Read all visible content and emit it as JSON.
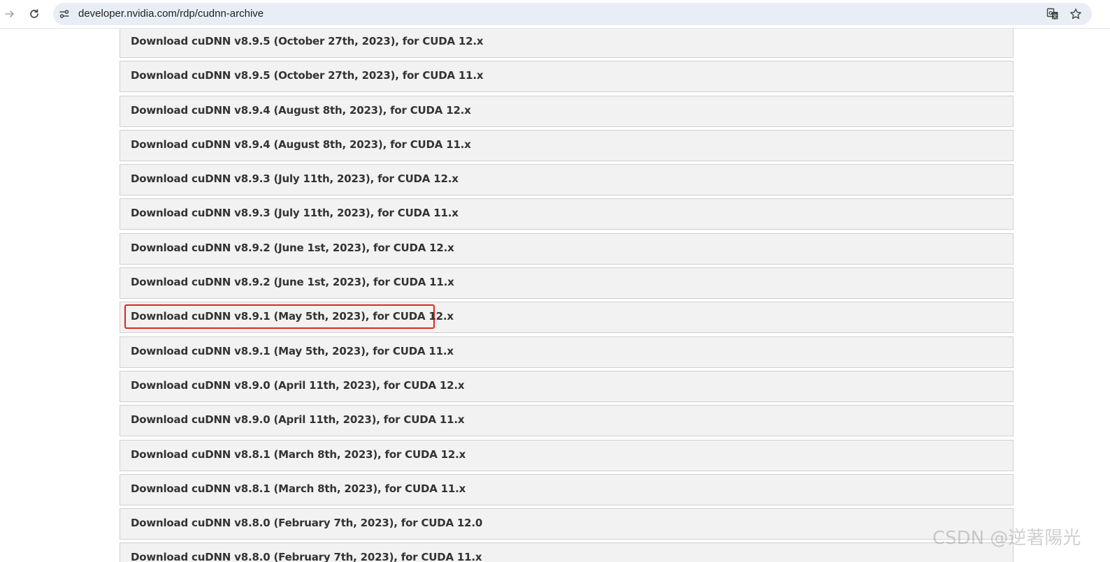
{
  "browser": {
    "url": "developer.nvidia.com/rdp/cudnn-archive",
    "icons": {
      "forward": "forward-arrow-icon",
      "reload": "reload-icon",
      "site_info": "site-settings-icon",
      "translate": "translate-icon",
      "bookmark": "bookmark-star-icon"
    }
  },
  "downloads": {
    "items": [
      {
        "label": "Download cuDNN v8.9.5 (October 27th, 2023), for CUDA 12.x"
      },
      {
        "label": "Download cuDNN v8.9.5 (October 27th, 2023), for CUDA 11.x"
      },
      {
        "label": "Download cuDNN v8.9.4 (August 8th, 2023), for CUDA 12.x"
      },
      {
        "label": "Download cuDNN v8.9.4 (August 8th, 2023), for CUDA 11.x"
      },
      {
        "label": "Download cuDNN v8.9.3 (July 11th, 2023), for CUDA 12.x"
      },
      {
        "label": "Download cuDNN v8.9.3 (July 11th, 2023), for CUDA 11.x"
      },
      {
        "label": "Download cuDNN v8.9.2 (June 1st, 2023), for CUDA 12.x"
      },
      {
        "label": "Download cuDNN v8.9.2 (June 1st, 2023), for CUDA 11.x"
      },
      {
        "label": "Download cuDNN v8.9.1 (May 5th, 2023), for CUDA 12.x",
        "highlighted": true
      },
      {
        "label": "Download cuDNN v8.9.1 (May 5th, 2023), for CUDA 11.x"
      },
      {
        "label": "Download cuDNN v8.9.0 (April 11th, 2023), for CUDA 12.x"
      },
      {
        "label": "Download cuDNN v8.9.0 (April 11th, 2023), for CUDA 11.x"
      },
      {
        "label": "Download cuDNN v8.8.1 (March 8th, 2023), for CUDA 12.x"
      },
      {
        "label": "Download cuDNN v8.8.1 (March 8th, 2023), for CUDA 11.x"
      },
      {
        "label": "Download cuDNN v8.8.0 (February 7th, 2023), for CUDA 12.0"
      },
      {
        "label": "Download cuDNN v8.8.0 (February 7th, 2023), for CUDA 11.x"
      }
    ]
  },
  "colors": {
    "highlight": "#e0261f",
    "item_bg": "#f2f2f2",
    "item_border": "#d0d0d0",
    "text": "#333333"
  },
  "watermark": "CSDN @逆著陽光"
}
